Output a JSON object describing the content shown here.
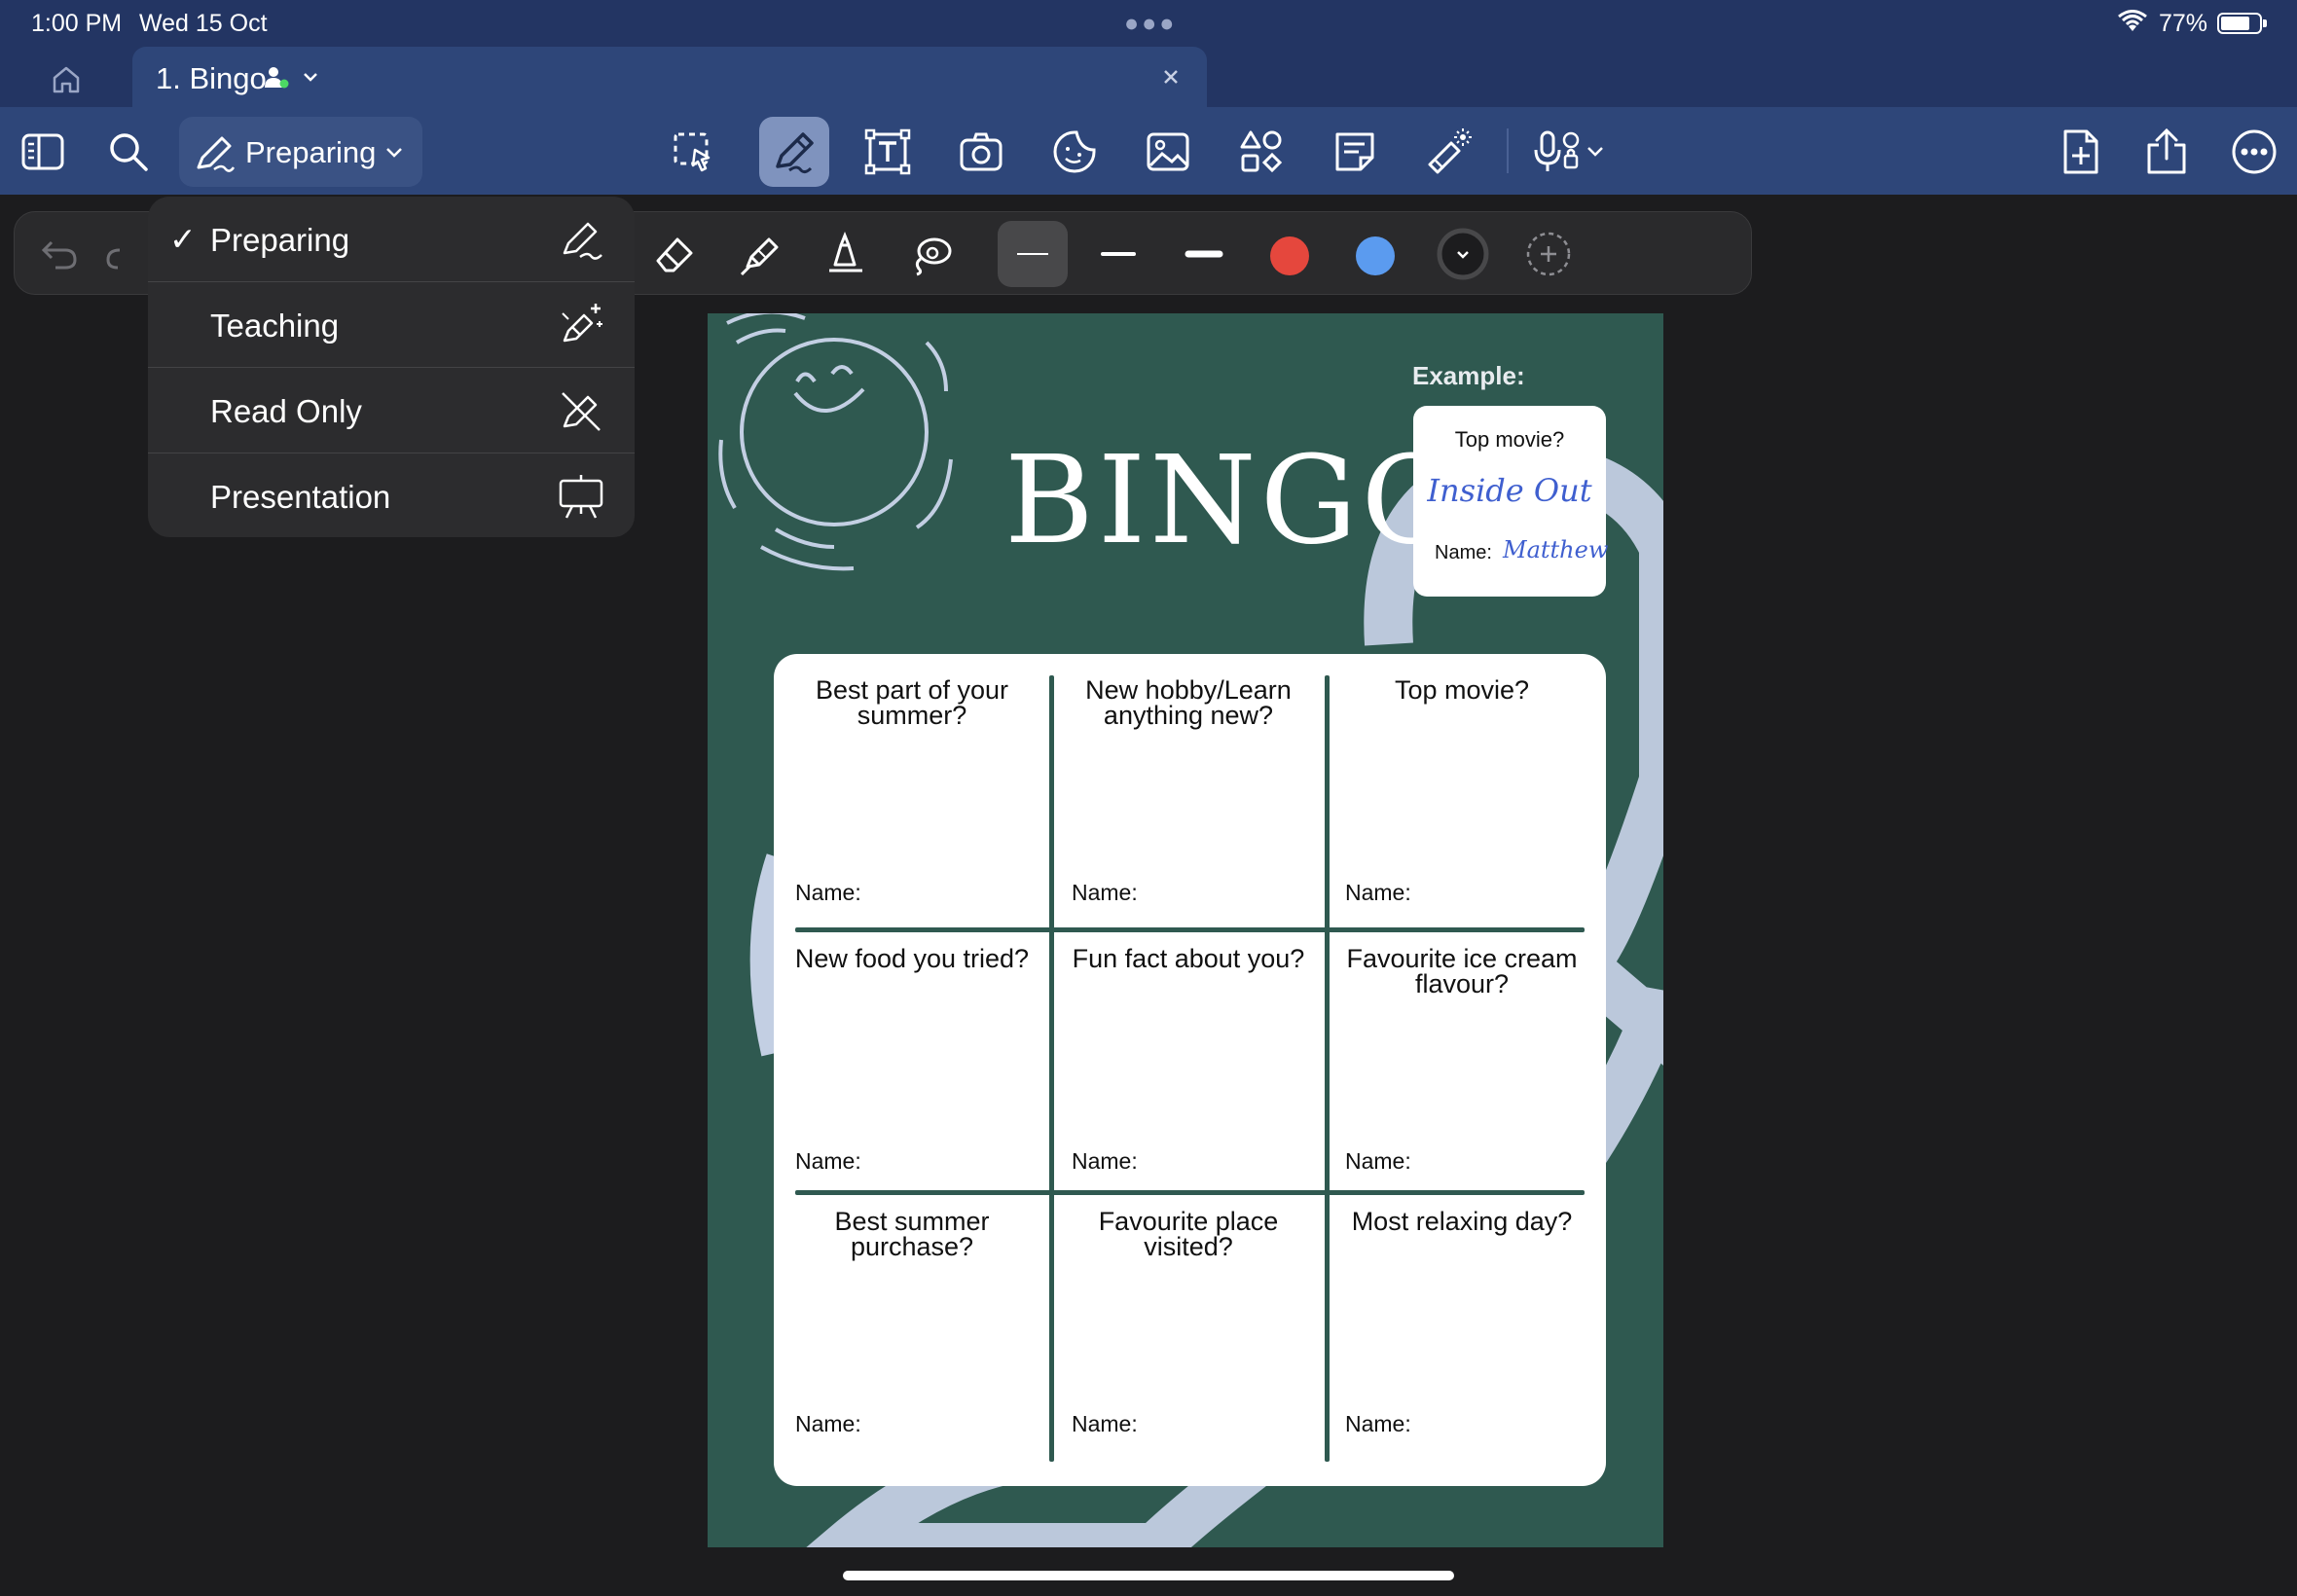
{
  "status_bar": {
    "time": "1:00 PM",
    "date": "Wed 15 Oct",
    "battery": "77%",
    "battery_level": 0.77
  },
  "tabs": [
    {
      "title": "1. Bingo",
      "active": true
    }
  ],
  "toolbar": {
    "mode_label": "Preparing",
    "icons": [
      "sidebar-icon",
      "search-icon",
      "lasso-icon",
      "pen-icon",
      "text-box-icon",
      "camera-icon",
      "sticker-icon",
      "image-icon",
      "shapes-icon",
      "sticky-note-icon",
      "laser-pointer-icon",
      "microphone-icon",
      "add-page-icon",
      "share-icon",
      "more-icon"
    ]
  },
  "subtoolbar": {
    "icons": [
      "undo-icon",
      "redo-icon",
      "eraser-icon",
      "highlighter-icon",
      "fountain-pen-icon",
      "lasso-shape-icon",
      "add-color-icon"
    ],
    "colors": {
      "red": "#e5473d",
      "blue": "#5b9bef",
      "black": "#1c1c1e"
    }
  },
  "mode_menu": {
    "items": [
      {
        "label": "Preparing",
        "checked": true,
        "icon": "pen-scribble-icon"
      },
      {
        "label": "Teaching",
        "checked": false,
        "icon": "pen-sparkle-icon"
      },
      {
        "label": "Read Only",
        "checked": false,
        "icon": "pen-disabled-icon"
      },
      {
        "label": "Presentation",
        "checked": false,
        "icon": "easel-icon"
      }
    ]
  },
  "document": {
    "title": "BINGO",
    "example_label": "Example:",
    "example_card": {
      "question": "Top movie?",
      "answer": "Inside Out",
      "name_label": "Name:",
      "name_value": "Matthew"
    },
    "cells": [
      {
        "question": "Best part of your summer?",
        "name_label": "Name:"
      },
      {
        "question": "New hobby/Learn anything new?",
        "name_label": "Name:"
      },
      {
        "question": "Top movie?",
        "name_label": "Name:"
      },
      {
        "question": "New food you tried?",
        "name_label": "Name:"
      },
      {
        "question": "Fun fact about you?",
        "name_label": "Name:"
      },
      {
        "question": "Favourite ice cream flavour?",
        "name_label": "Name:"
      },
      {
        "question": "Best summer purchase?",
        "name_label": "Name:"
      },
      {
        "question": "Favourite place visited?",
        "name_label": "Name:"
      },
      {
        "question": "Most relaxing day?",
        "name_label": "Name:"
      }
    ],
    "colors": {
      "background": "#2f5950",
      "accent": "#c3cfe3"
    }
  }
}
